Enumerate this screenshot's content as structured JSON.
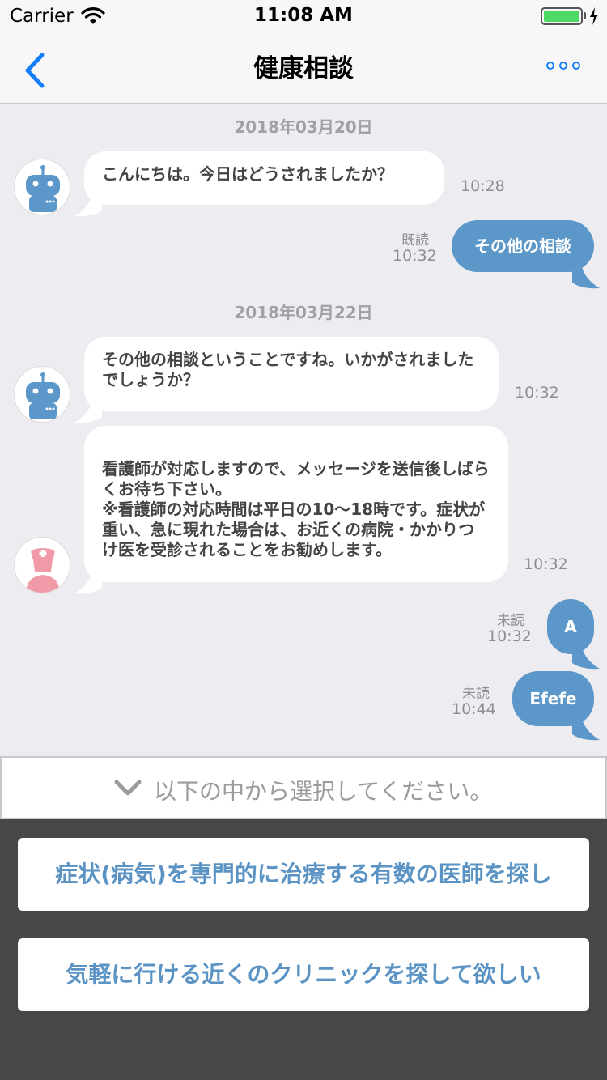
{
  "status_bar": {
    "carrier": "Carrier",
    "time": "11:08 AM"
  },
  "nav": {
    "title": "健康相談",
    "back_icon": "chevron-left-icon",
    "more_icon": "ellipsis-icon"
  },
  "chat": {
    "date1": "2018年03月20日",
    "date2": "2018年03月22日",
    "messages": [
      {
        "sender": "bot",
        "text": "こんにちは。今日はどうされましたか？",
        "time": "10:28"
      },
      {
        "sender": "user",
        "text": "その他の相談",
        "read": "既読",
        "time": "10:32"
      },
      {
        "sender": "bot",
        "text": "その他の相談ということですね。いかがされましたでしょうか？",
        "time": "10:32"
      },
      {
        "sender": "nurse",
        "text": "看護師が対応しますので、メッセージを送信後しばらくお待ち下さい。\n※看護師の対応時間は平日の10〜18時です。症状が重い、急に現れた場合は、お近くの病院・かかりつけ医を受診されることをお勧めします。",
        "time": "10:32"
      },
      {
        "sender": "user",
        "text": "A",
        "read": "未読",
        "time": "10:32"
      },
      {
        "sender": "user",
        "text": "Efefe",
        "read": "未読",
        "time": "10:44"
      }
    ]
  },
  "choices": {
    "header": "以下の中から選択してください。",
    "options": [
      "症状(病気)を専門的に治療する有数の医師を探し",
      "気軽に行ける近くのクリニックを探して欲しい"
    ]
  },
  "colors": {
    "accent": "#5b97c8",
    "ios_blue": "#157efb",
    "panel_bg": "#474747"
  }
}
